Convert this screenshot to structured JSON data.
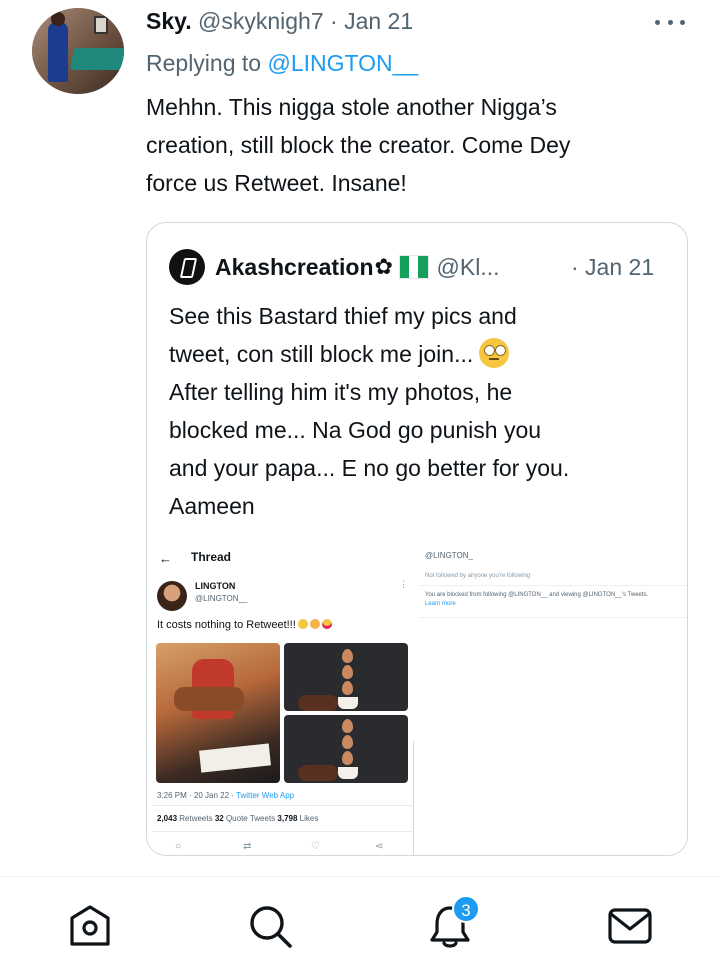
{
  "tweet": {
    "author_name": "Sky.",
    "author_handle": "@skyknigh7",
    "date": "Jan 21",
    "replying_to_label": "Replying to",
    "replying_to_handle": "@LINGTON__",
    "text_lines": [
      "Mehhn. This nigga stole another Nigga’s",
      "creation, still block the creator. Come Dey",
      "force us Retweet. Insane!"
    ],
    "more_icon": "more-horizontal-icon"
  },
  "quote": {
    "author_name": "Akashcreation",
    "badge_icon": "flower-badge-icon",
    "flag": "nigeria-flag",
    "author_handle": "@Kl...",
    "date": "· Jan 21",
    "text_lines": [
      "See this Bastard thief my pics and",
      "tweet, con still block me join...",
      "After telling him it's my photos, he",
      "blocked me... Na God go punish you",
      "and your papa... E no go better for you.",
      "Aameen"
    ],
    "embedded": {
      "thread_title": "Thread",
      "user_name": "LINGTON",
      "user_handle": "@LINGTON__",
      "tweet_text": "It costs nothing to Retweet!!!",
      "timestamp": "3:26 PM · 20 Jan 22 · ",
      "app": "Twitter Web App",
      "retweets": "2,043",
      "retweets_label": " Retweets  ",
      "quote_tweets": "32",
      "quote_tweets_label": " Quote Tweets  ",
      "likes": "3,798",
      "likes_label": " Likes",
      "right_handle": "@LINGTON_",
      "right_follow": "Not followed by anyone you're following",
      "right_blocked": "You are blocked from following @LINGTON__ and viewing @LINGTON__'s Tweets.",
      "right_learn_more": "Learn more"
    }
  },
  "bottom_nav": {
    "items": [
      "home-icon",
      "search-icon",
      "notifications-icon",
      "messages-icon"
    ],
    "notification_count": "3"
  },
  "colors": {
    "accent": "#1d9bf0",
    "text_primary": "#0f1419",
    "text_secondary": "#536471",
    "border": "#cfd9de"
  }
}
